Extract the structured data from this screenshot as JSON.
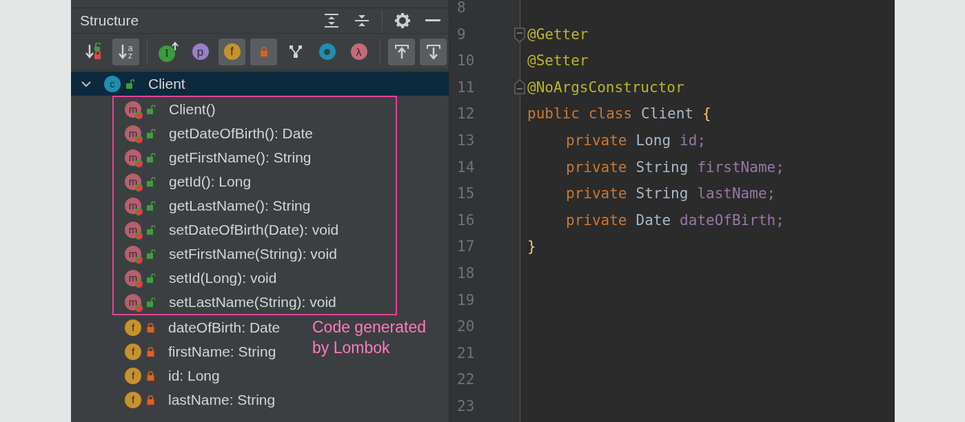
{
  "structure": {
    "title": "Structure",
    "header_buttons": [
      {
        "kind": "expand"
      },
      {
        "kind": "collapse"
      },
      {
        "kind": "settings"
      },
      {
        "kind": "hide"
      }
    ],
    "toolbar": [
      {
        "kind": "sort-visibility",
        "selected": false
      },
      {
        "kind": "sort-alpha",
        "glyph_top": "a",
        "glyph_bottom": "z",
        "selected": true
      },
      {
        "kind": "separator"
      },
      {
        "kind": "inherited",
        "glyph": "I",
        "selected": false
      },
      {
        "kind": "properties",
        "glyph": "p",
        "selected": false
      },
      {
        "kind": "fields",
        "glyph": "f",
        "selected": true
      },
      {
        "kind": "non-public",
        "selected": true
      },
      {
        "kind": "hierarchy",
        "selected": false
      },
      {
        "kind": "anonymous",
        "selected": false
      },
      {
        "kind": "lambdas",
        "glyph": "λ",
        "selected": false
      },
      {
        "kind": "separator"
      },
      {
        "kind": "scroll-from-source",
        "selected": true
      },
      {
        "kind": "scroll-to-source",
        "selected": true
      }
    ],
    "tree": [
      {
        "label": "Client",
        "badge": "c",
        "kind": "class",
        "locked": false,
        "expanded": true,
        "selected": true,
        "children": [
          {
            "label": "Client()",
            "badge": "m",
            "kind": "method",
            "locked": false,
            "highlighted": true
          },
          {
            "label": "getDateOfBirth(): Date",
            "badge": "m",
            "kind": "method",
            "locked": false,
            "highlighted": true
          },
          {
            "label": "getFirstName(): String",
            "badge": "m",
            "kind": "method",
            "locked": false,
            "highlighted": true
          },
          {
            "label": "getId(): Long",
            "badge": "m",
            "kind": "method",
            "locked": false,
            "highlighted": true
          },
          {
            "label": "getLastName(): String",
            "badge": "m",
            "kind": "method",
            "locked": false,
            "highlighted": true
          },
          {
            "label": "setDateOfBirth(Date): void",
            "badge": "m",
            "kind": "method",
            "locked": false,
            "highlighted": true
          },
          {
            "label": "setFirstName(String): void",
            "badge": "m",
            "kind": "method",
            "locked": false,
            "highlighted": true
          },
          {
            "label": "setId(Long): void",
            "badge": "m",
            "kind": "method",
            "locked": false,
            "highlighted": true
          },
          {
            "label": "setLastName(String): void",
            "badge": "m",
            "kind": "method",
            "locked": false,
            "highlighted": true
          },
          {
            "label": "dateOfBirth: Date",
            "badge": "f",
            "kind": "field",
            "locked": true,
            "highlighted": false
          },
          {
            "label": "firstName: String",
            "badge": "f",
            "kind": "field",
            "locked": true,
            "highlighted": false
          },
          {
            "label": "id: Long",
            "badge": "f",
            "kind": "field",
            "locked": true,
            "highlighted": false
          },
          {
            "label": "lastName: String",
            "badge": "f",
            "kind": "field",
            "locked": true,
            "highlighted": false
          }
        ]
      }
    ],
    "annotation": [
      "Code generated",
      "by Lombok"
    ]
  },
  "editor": {
    "lines": [
      {
        "number": "8"
      },
      {
        "number": "9",
        "fold_open": true,
        "tokens": [
          {
            "text": "@Getter",
            "kind": "annotation"
          }
        ]
      },
      {
        "number": "10",
        "tokens": [
          {
            "text": "@Setter",
            "kind": "annotation"
          }
        ]
      },
      {
        "number": "11",
        "fold_close": true,
        "tokens": [
          {
            "text": "@NoArgsConstructor",
            "kind": "annotation"
          }
        ]
      },
      {
        "number": "12",
        "tokens": [
          {
            "text": "public",
            "kind": "keyword"
          },
          {
            "text": "class",
            "kind": "keyword"
          },
          {
            "text": "Client",
            "kind": "type"
          },
          {
            "text": "{",
            "kind": "brace"
          }
        ],
        "children": [
          {
            "number": "13",
            "tokens": [
              {
                "text": "private",
                "kind": "keyword"
              },
              {
                "text": "Long",
                "kind": "type"
              },
              {
                "text": "id;",
                "kind": "field"
              }
            ]
          },
          {
            "number": "14",
            "tokens": [
              {
                "text": "private",
                "kind": "keyword"
              },
              {
                "text": "String",
                "kind": "type"
              },
              {
                "text": "firstName;",
                "kind": "field"
              }
            ]
          },
          {
            "number": "15",
            "tokens": [
              {
                "text": "private",
                "kind": "keyword"
              },
              {
                "text": "String",
                "kind": "type"
              },
              {
                "text": "lastName;",
                "kind": "field"
              }
            ]
          },
          {
            "number": "16",
            "tokens": [
              {
                "text": "private",
                "kind": "keyword"
              },
              {
                "text": "Date",
                "kind": "type"
              },
              {
                "text": "dateOfBirth;",
                "kind": "field"
              }
            ]
          }
        ]
      },
      {
        "number": "17",
        "tokens": [
          {
            "text": "}",
            "kind": "brace"
          }
        ]
      },
      {
        "number": "18"
      },
      {
        "number": "19"
      },
      {
        "number": "20"
      },
      {
        "number": "21"
      },
      {
        "number": "22"
      },
      {
        "number": "23"
      }
    ]
  }
}
